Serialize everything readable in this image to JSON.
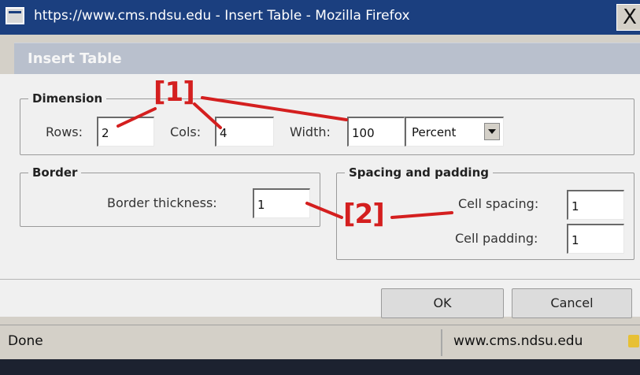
{
  "window": {
    "title": "https://www.cms.ndsu.edu - Insert Table - Mozilla Firefox",
    "close_icon": "close-icon",
    "close_glyph": "X"
  },
  "dialog": {
    "title": "Insert Table",
    "dimension": {
      "legend": "Dimension",
      "rows_label": "Rows:",
      "rows_value": "2",
      "cols_label": "Cols:",
      "cols_value": "4",
      "width_label": "Width:",
      "width_value": "100",
      "unit_selected": "Percent"
    },
    "border": {
      "legend": "Border",
      "thickness_label": "Border thickness:",
      "thickness_value": "1"
    },
    "spacing": {
      "legend": "Spacing and padding",
      "cell_spacing_label": "Cell spacing:",
      "cell_spacing_value": "1",
      "cell_padding_label": "Cell padding:",
      "cell_padding_value": "1"
    },
    "buttons": {
      "ok": "OK",
      "cancel": "Cancel"
    }
  },
  "annotations": {
    "a1": "[1]",
    "a2": "[2]",
    "color": "#d41f1f"
  },
  "status": {
    "left": "Done",
    "right": "www.cms.ndsu.edu",
    "lock_icon": "lock-icon"
  }
}
